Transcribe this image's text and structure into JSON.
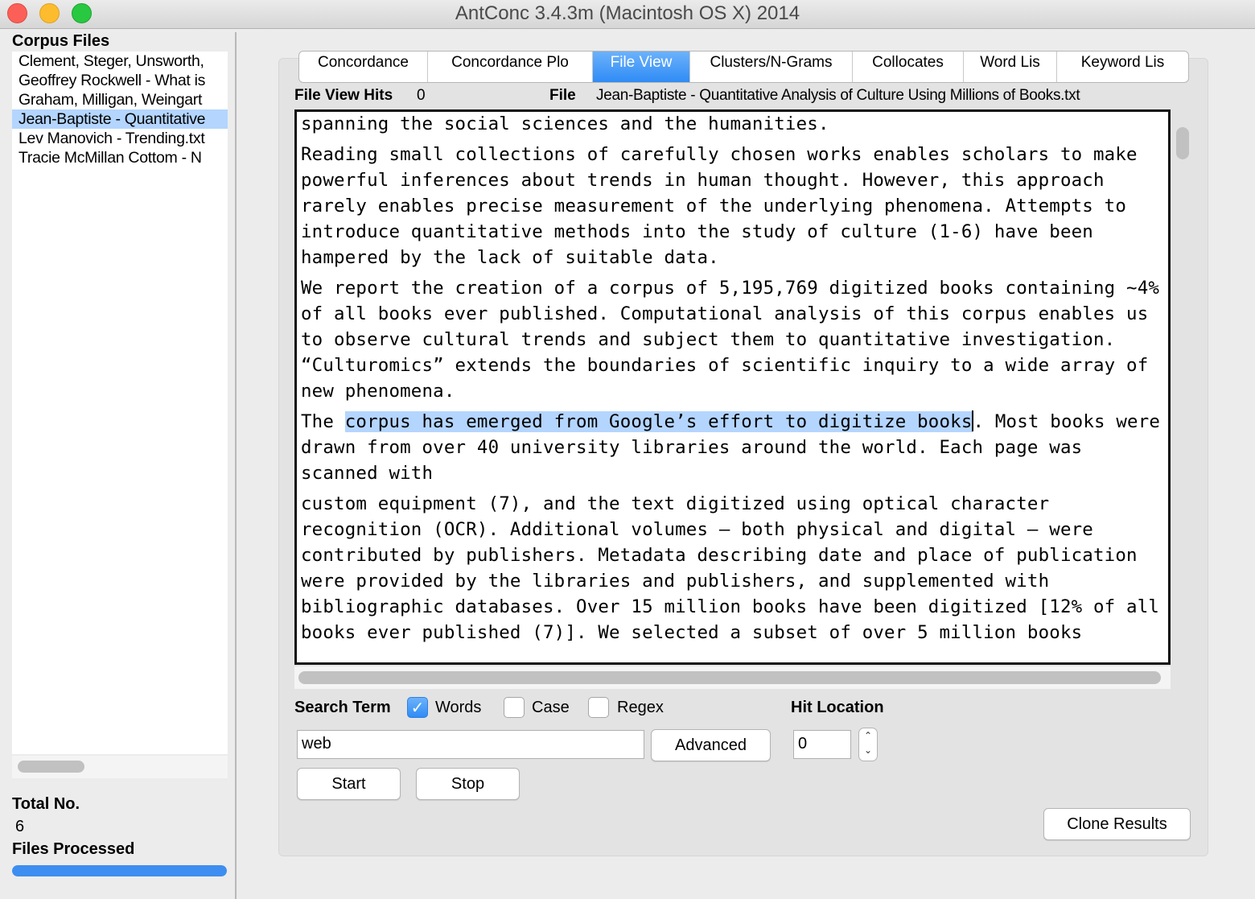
{
  "window": {
    "title": "AntConc 3.4.3m (Macintosh OS X) 2014"
  },
  "sidebar": {
    "corpus_label": "Corpus Files",
    "files": [
      "Clement, Steger, Unsworth, ",
      "Geoffrey Rockwell - What is",
      "Graham, Milligan, Weingart ",
      "Jean-Baptiste - Quantitative",
      "Lev Manovich - Trending.txt",
      "Tracie McMillan Cottom - N"
    ],
    "selected_index": 3,
    "total_label": "Total No.",
    "total_value": "6",
    "processed_label": "Files Processed",
    "progress_percent": 100
  },
  "tabs": [
    {
      "label": "Concordance",
      "active": false
    },
    {
      "label": "Concordance Plo",
      "active": false
    },
    {
      "label": "File View",
      "active": true
    },
    {
      "label": "Clusters/N-Grams",
      "active": false
    },
    {
      "label": "Collocates",
      "active": false
    },
    {
      "label": "Word Lis",
      "active": false
    },
    {
      "label": "Keyword Lis",
      "active": false
    }
  ],
  "file_view": {
    "hits_label": "File View Hits",
    "hits_value": "0",
    "file_label": "File",
    "file_name": "Jean-Baptiste - Quantitative Analysis of Culture Using Millions of Books.txt",
    "paragraphs": {
      "p1": "spanning the social sciences and the humanities.",
      "p2": "Reading small collections of carefully chosen works enables scholars to make powerful inferences about trends in human thought. However, this approach rarely enables precise measurement of the underlying phenomena. Attempts to introduce quantitative methods into the study of culture (1-6) have been hampered by the lack of suitable data.",
      "p3": "We report the creation of a corpus of 5,195,769 digitized books containing ~4% of all books ever published. Computational analysis of this corpus enables us to observe cultural trends and subject them to quantitative investigation. “Culturomics” extends the boundaries of scientific inquiry to a wide array of new phenomena.",
      "p4_before": "The ",
      "p4_highlight": "corpus has emerged from Google’s effort to digitize books",
      "p4_after": ". Most books were drawn from over 40 university libraries around the world. Each page was scanned with",
      "p5": "custom equipment (7), and the text digitized using optical character recognition (OCR). Additional volumes – both physical and digital – were contributed by publishers. Metadata describing date and place of publication were provided by the libraries and publishers, and supplemented with bibliographic databases. Over 15 million books have been digitized [12% of all books ever published (7)]. We selected a subset of over 5 million books"
    }
  },
  "search": {
    "label": "Search Term",
    "words_label": "Words",
    "words_checked": true,
    "case_label": "Case",
    "case_checked": false,
    "regex_label": "Regex",
    "regex_checked": false,
    "value": "web",
    "advanced_label": "Advanced",
    "start_label": "Start",
    "stop_label": "Stop",
    "hit_location_label": "Hit Location",
    "hit_location_value": "0",
    "clone_label": "Clone Results"
  }
}
